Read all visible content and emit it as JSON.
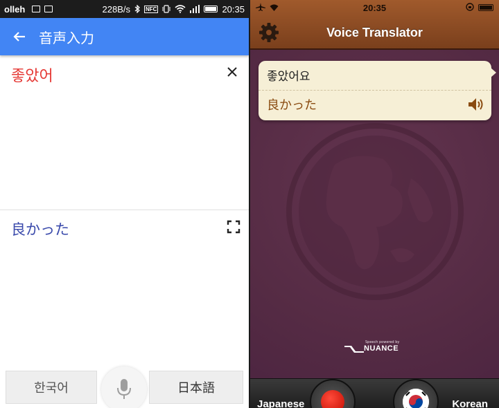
{
  "left": {
    "status": {
      "carrier": "olleh",
      "speed": "228B/s",
      "nfc": "NFC",
      "time": "20:35"
    },
    "appbar": {
      "title": "音声入力"
    },
    "source": {
      "text": "좋았어"
    },
    "target": {
      "text": "良かった"
    },
    "bottom": {
      "lang_left": "한국어",
      "lang_right": "日本語"
    },
    "colors": {
      "appbar": "#4285f4",
      "source_text": "#e53935",
      "target_text": "#3949ab"
    }
  },
  "right": {
    "status": {
      "time": "20:35"
    },
    "nav": {
      "title": "Voice Translator"
    },
    "bubble": {
      "source": "좋았어요",
      "target": "良かった"
    },
    "branding": {
      "powered": "Speech powered by",
      "name": "NUANCE"
    },
    "bottom": {
      "lang_left": "Japanese",
      "lang_right": "Korean"
    },
    "colors": {
      "background": "#5a2f48",
      "header": "#8a4a22",
      "target_text": "#8a4b10",
      "record": "#e01a0a"
    }
  }
}
